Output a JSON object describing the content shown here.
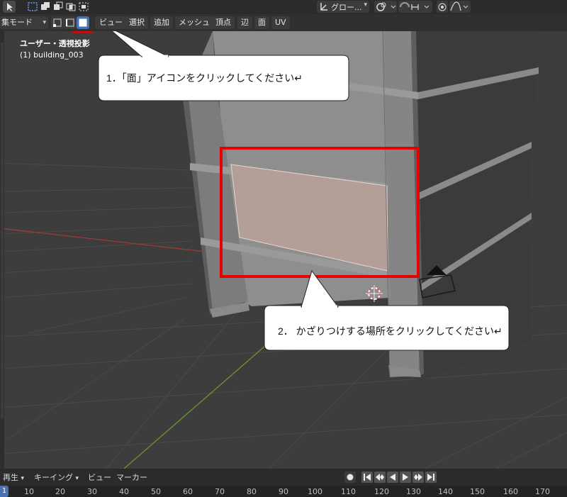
{
  "top_toolbar": {
    "orientation_label": "グロー...",
    "icons": [
      "cursor-icon",
      "select-box-icon",
      "select-extend-icon",
      "select-subtract-icon",
      "select-intersect-icon",
      "transform-orientation-icon",
      "snap-icon",
      "proportional-edit-icon"
    ]
  },
  "header": {
    "mode_label": "集モード",
    "menus": [
      "ビュー",
      "選択",
      "追加",
      "メッシュ",
      "頂点",
      "辺",
      "面",
      "UV"
    ],
    "select_modes": [
      "vertex",
      "edge",
      "face"
    ],
    "active_select_mode": "face"
  },
  "viewport": {
    "view_label": "ユーザー・透視投影",
    "object_label": "(1) building_003"
  },
  "callouts": [
    {
      "text": "1．「面」アイコンをクリックしてください↵"
    },
    {
      "text": "2．  かざりつけする場所をクリックしてください↵"
    }
  ],
  "timeline": {
    "menus": [
      "再生",
      "キーイング",
      "ビュー",
      "マーカー"
    ],
    "current_frame": "1",
    "ticks": [
      "10",
      "20",
      "30",
      "40",
      "50",
      "60",
      "70",
      "80",
      "90",
      "100",
      "110",
      "120",
      "130",
      "140",
      "150",
      "160",
      "170"
    ]
  },
  "colors": {
    "highlight_red": "#e60000",
    "selected_face": "#b49f98",
    "active_blue": "#4772b3",
    "viewport_bg": "#3d3d3d"
  }
}
